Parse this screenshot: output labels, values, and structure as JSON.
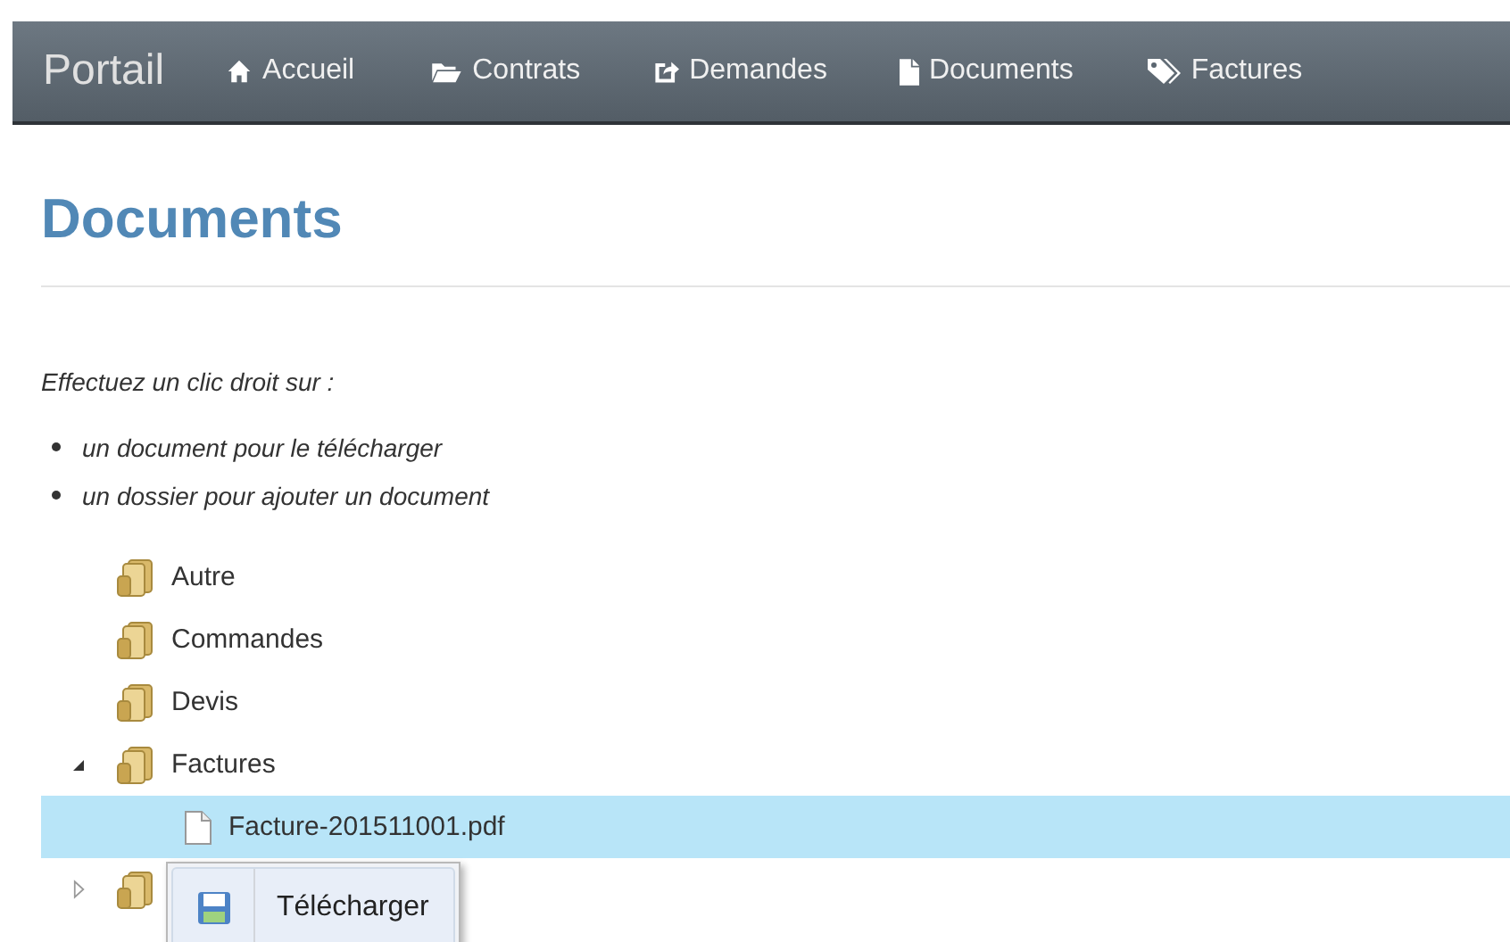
{
  "navbar": {
    "brand": "Portail",
    "items": [
      {
        "label": "Accueil",
        "kind": "home"
      },
      {
        "label": "Contrats",
        "kind": "folder"
      },
      {
        "label": "Demandes",
        "kind": "share"
      },
      {
        "label": "Documents",
        "kind": "file"
      },
      {
        "label": "Factures",
        "kind": "tags"
      }
    ]
  },
  "heading": "Documents",
  "instructions": {
    "intro": "Effectuez un clic droit sur :",
    "bullets": [
      "un document pour le télécharger",
      "un dossier pour ajouter un document"
    ]
  },
  "tree": [
    {
      "kind": "folder",
      "label": "Autre",
      "selected": false
    },
    {
      "kind": "folder",
      "label": "Commandes",
      "selected": false
    },
    {
      "kind": "folder",
      "label": "Devis",
      "selected": false
    },
    {
      "kind": "folder",
      "label": "Factures",
      "selected": false,
      "expanded": true,
      "children": [
        {
          "kind": "file",
          "label": "Facture-201511001.pdf",
          "selected": true
        }
      ]
    },
    {
      "kind": "folder",
      "selected": false,
      "expanded": false
    }
  ],
  "context_menu": {
    "items": [
      {
        "label": "Télécharger",
        "kind": "save"
      }
    ]
  }
}
